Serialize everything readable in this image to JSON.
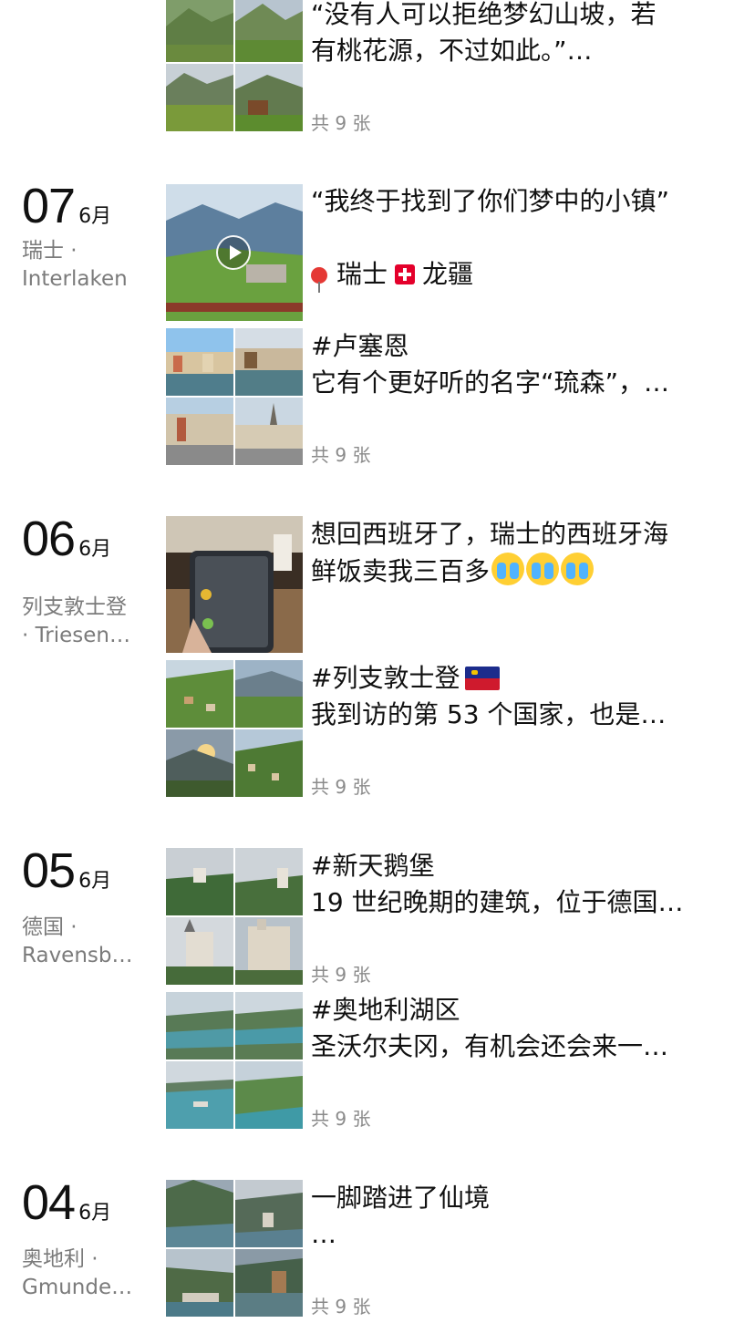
{
  "top_post": {
    "text_lines": [
      "“没有人可以拒绝梦幻山坡，若",
      "有桃花源，不过如此。”…"
    ],
    "photo_count": "共 9 张"
  },
  "days": [
    {
      "day": "07",
      "month": "6月",
      "location_lines": [
        "瑞士 ·",
        "Interlaken"
      ],
      "video_post": {
        "title": "“我终于找到了你们梦中的小镇”",
        "location_text": "瑞士",
        "location_text2": "龙疆",
        "pin_icon": "pin-icon",
        "flag_icon": "swiss-flag-icon"
      },
      "post": {
        "text_lines": [
          "#卢塞恩",
          "它有个更好听的名字“琉森”，…"
        ],
        "photo_count": "共 9 张"
      }
    },
    {
      "day": "06",
      "month": "6月",
      "location_lines": [
        "列支敦士登",
        "· Triesen…"
      ],
      "single_post": {
        "text_lines": [
          "想回西班牙了，瑞士的西班牙海",
          "鲜饭卖我三百多"
        ],
        "emoji_icon": "crying-face-icon"
      },
      "post": {
        "text_lines": [
          "#列支敦士登",
          "我到访的第 53 个国家，也是…"
        ],
        "photo_count": "共 9 张",
        "flag_icon": "liechtenstein-flag-icon"
      }
    },
    {
      "day": "05",
      "month": "6月",
      "location_lines": [
        "德国 ·",
        "Ravensb…"
      ],
      "post": {
        "text_lines": [
          "#新天鹅堡",
          "19 世纪晚期的建筑，位于德国…"
        ],
        "photo_count": "共 9 张"
      },
      "post2": {
        "text_lines": [
          "#奥地利湖区",
          "圣沃尔夫冈，有机会还会来一…"
        ],
        "photo_count": "共 9 张"
      }
    },
    {
      "day": "04",
      "month": "6月",
      "location_lines": [
        "奥地利 ·",
        "Gmunde…"
      ],
      "post": {
        "text_lines": [
          "一脚踏进了仙境",
          "…"
        ],
        "photo_count": "共 9 张"
      }
    }
  ],
  "colors": {
    "text": "#111111",
    "secondary": "#7b7b7b",
    "count": "#8a8a8a"
  }
}
